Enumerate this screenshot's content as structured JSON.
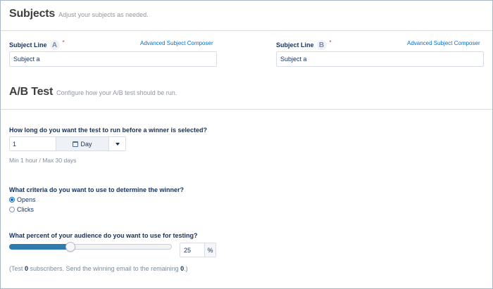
{
  "subjects": {
    "title": "Subjects",
    "subtitle": "Adjust your subjects as needed.",
    "fields": [
      {
        "label": "Subject Line",
        "badge": "A",
        "required": "*",
        "link": "Advanced Subject Composer",
        "value": "Subject a"
      },
      {
        "label": "Subject Line",
        "badge": "B",
        "required": "*",
        "link": "Advanced Subject Composer",
        "value": "Subject a"
      }
    ]
  },
  "ab_test": {
    "title": "A/B Test",
    "subtitle": "Configure how your A/B test should be run.",
    "duration": {
      "question": "How long do you want the test to run before a winner is selected?",
      "value": "1",
      "unit": "Day",
      "hint": "Min 1 hour / Max 30 days"
    },
    "criteria": {
      "question": "What criteria do you want to use to determine the winner?",
      "options": [
        {
          "label": "Opens",
          "checked": true
        },
        {
          "label": "Clicks",
          "checked": false
        }
      ]
    },
    "percent": {
      "question": "What percent of your audience do you want to use for testing?",
      "value": "25",
      "suffix": "%",
      "slider_fraction": 0.375
    },
    "summary": {
      "prefix": "(Test ",
      "test_count": "0",
      "middle": " subscribers. Send the winning email to the remaining ",
      "remaining_count": "0",
      "suffix": ".)"
    }
  },
  "colors": {
    "accent": "#0070d2",
    "slider_fill": "#2e7bad",
    "required": "#c23934"
  },
  "icons": {
    "calendar": "calendar-icon",
    "caret": "chevron-down-icon"
  }
}
